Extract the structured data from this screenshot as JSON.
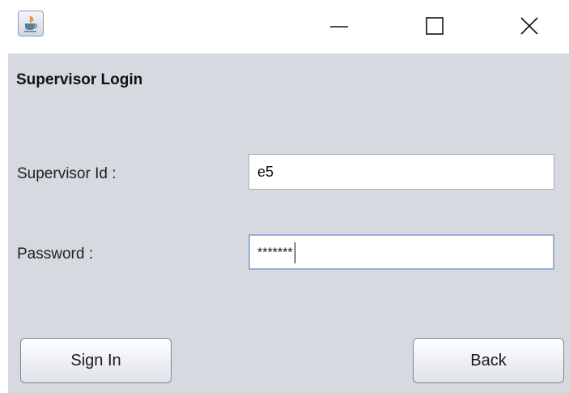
{
  "window": {
    "icons": {
      "app": "java-cup-icon",
      "minimize": "minimize-icon",
      "maximize": "maximize-icon",
      "close": "close-icon"
    }
  },
  "form": {
    "heading": "Supervisor Login",
    "supervisor_id": {
      "label": "Supervisor Id :",
      "value": "e5"
    },
    "password": {
      "label": "Password :",
      "value_masked": "*******"
    }
  },
  "buttons": {
    "sign_in": "Sign In",
    "back": "Back"
  },
  "colors": {
    "panel_background": "#d6d9e0",
    "focus_border": "#8fb2d8"
  }
}
